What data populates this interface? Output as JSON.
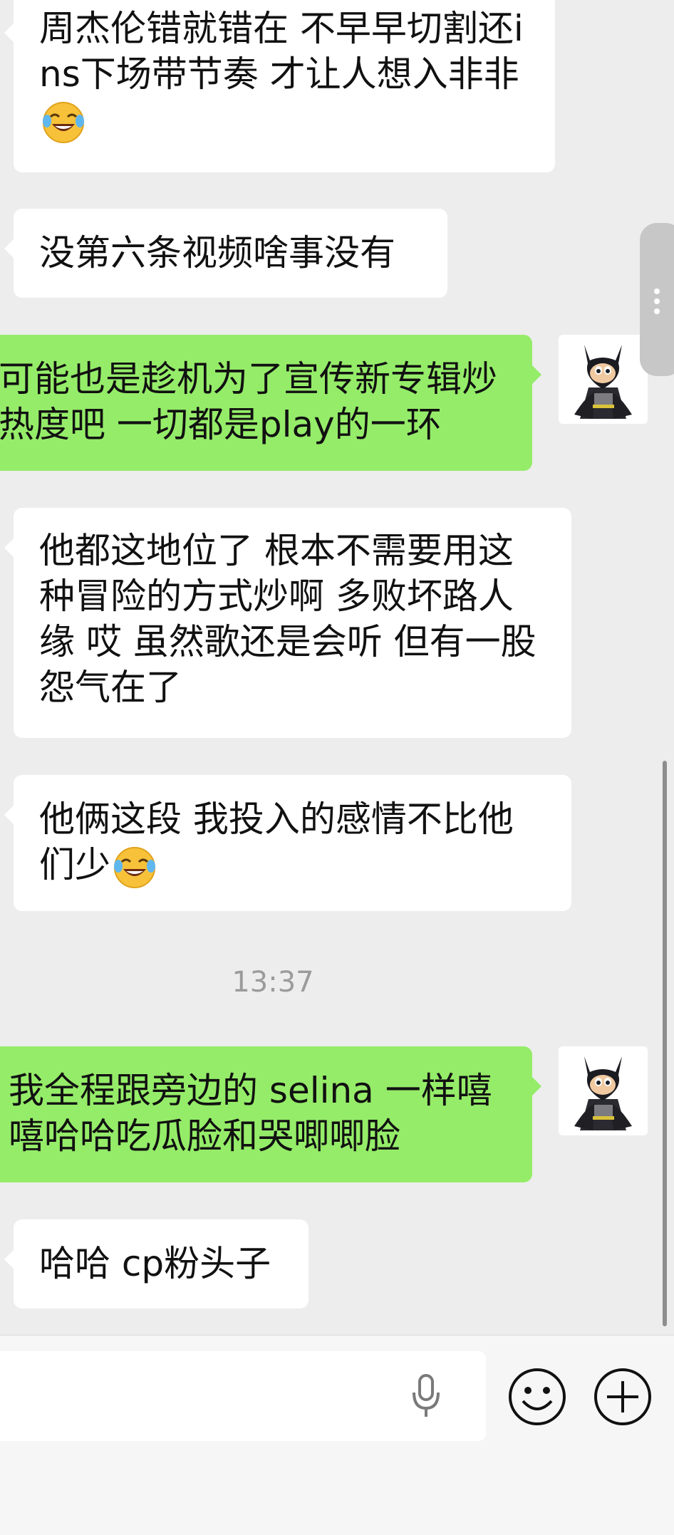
{
  "messages": [
    {
      "side": "in",
      "text": "周杰伦错就错在 不早早切割还ins下场带节奏 才让人想入非非",
      "emoji": "face-with-tears-of-joy"
    },
    {
      "side": "in",
      "text": "没第六条视频啥事没有"
    },
    {
      "side": "out",
      "text": "可能也是趁机为了宣传新专辑炒热度吧 一切都是play的一环"
    },
    {
      "side": "in",
      "text": "他都这地位了 根本不需要用这种冒险的方式炒啊 多败坏路人缘 哎 虽然歌还是会听 但有一股怨气在了"
    },
    {
      "side": "in",
      "text": "他俩这段 我投入的感情不比他们少",
      "emoji": "face-with-tears-of-joy"
    },
    {
      "side": "out",
      "text": "我全程跟旁边的 selina 一样嘻嘻哈哈吃瓜脸和哭唧唧脸"
    },
    {
      "side": "in",
      "text": "哈哈 cp粉头子"
    }
  ],
  "timestamp": "13:37",
  "avatar_icon": "batman-figure-avatar",
  "input_bar": {
    "text_value": "",
    "icons": [
      "microphone-icon",
      "emoji-icon",
      "plus-icon"
    ]
  },
  "colors": {
    "background": "#ededed",
    "incoming_bubble": "#ffffff",
    "outgoing_bubble": "#95ec69",
    "timestamp_text": "#9b9b9b"
  }
}
